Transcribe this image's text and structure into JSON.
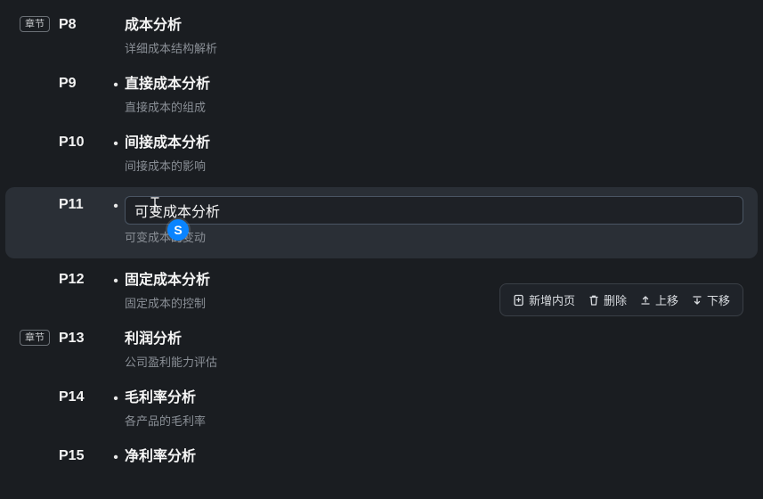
{
  "badges": {
    "chapter": "章节"
  },
  "rows": [
    {
      "page": "P8",
      "chapter": true,
      "bullet": false,
      "title": "成本分析",
      "subtitle": "详细成本结构解析"
    },
    {
      "page": "P9",
      "chapter": false,
      "bullet": true,
      "title": "直接成本分析",
      "subtitle": "直接成本的组成"
    },
    {
      "page": "P10",
      "chapter": false,
      "bullet": true,
      "title": "间接成本分析",
      "subtitle": "间接成本的影响"
    },
    {
      "page": "P11",
      "chapter": false,
      "bullet": true,
      "title": "可变成本分析",
      "subtitle": "可变成本的变动",
      "editing": true
    },
    {
      "page": "P12",
      "chapter": false,
      "bullet": true,
      "title": "固定成本分析",
      "subtitle": "固定成本的控制"
    },
    {
      "page": "P13",
      "chapter": true,
      "bullet": false,
      "title": "利润分析",
      "subtitle": "公司盈利能力评估"
    },
    {
      "page": "P14",
      "chapter": false,
      "bullet": true,
      "title": "毛利率分析",
      "subtitle": "各产品的毛利率"
    },
    {
      "page": "P15",
      "chapter": false,
      "bullet": true,
      "title": "净利率分析",
      "subtitle": ""
    }
  ],
  "toolbar": {
    "add": "新增内页",
    "delete": "删除",
    "up": "上移",
    "down": "下移"
  },
  "bullet_glyph": "•",
  "cursor_badge": "S"
}
